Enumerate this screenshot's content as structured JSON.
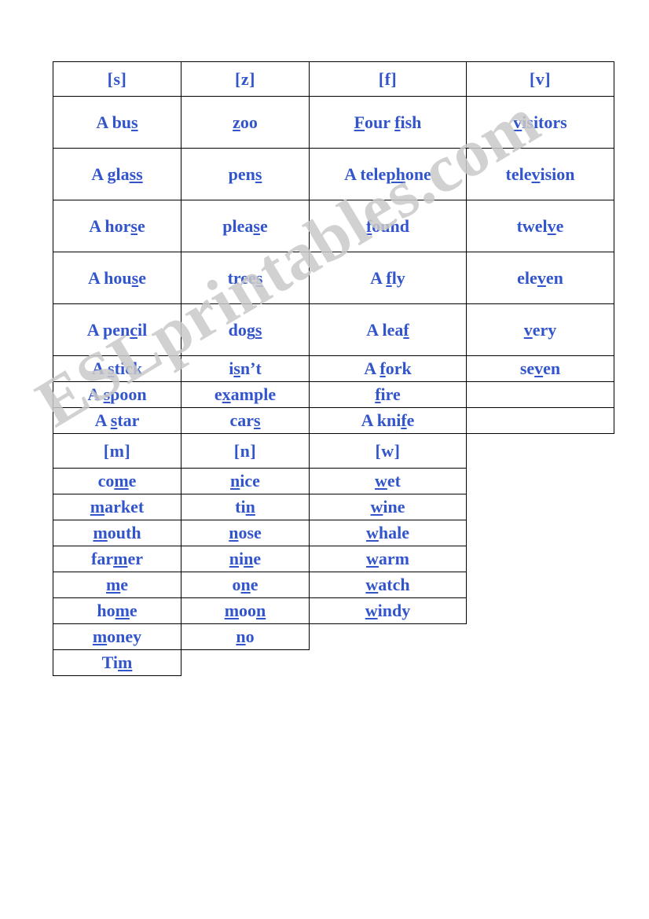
{
  "document": {
    "type": "pronunciation-worksheet",
    "watermark": "ESLprintables.com",
    "colors": {
      "header_red": "#dd1111",
      "word_blue": "#3355cc",
      "border": "#000000",
      "watermark_gray": "#c9c9c9"
    }
  },
  "table": {
    "headers": [
      "[s]",
      "[z]",
      "[f]",
      "[v]",
      "[m]",
      "[n]",
      "[w]"
    ],
    "sound_s": {
      "symbol": "[s]",
      "words": [
        {
          "text": "A bus",
          "pre": "A bu",
          "mark": "s",
          "post": ""
        },
        {
          "text": "A glass",
          "pre": "A gla",
          "mark": "ss",
          "post": ""
        },
        {
          "text": "A horse",
          "pre": "A hor",
          "mark": "s",
          "post": "e"
        },
        {
          "text": "A house",
          "pre": "A hou",
          "mark": "s",
          "post": "e"
        },
        {
          "text": "A pencil",
          "pre": "A pen",
          "mark": "c",
          "post": "il"
        },
        {
          "text": "A stick",
          "pre": "A ",
          "mark": "s",
          "post": "tick"
        },
        {
          "text": "A spoon",
          "pre": "A ",
          "mark": "s",
          "post": "poon"
        },
        {
          "text": "A star",
          "pre": "A ",
          "mark": "s",
          "post": "tar"
        }
      ]
    },
    "sound_z": {
      "symbol": "[z]",
      "words": [
        {
          "text": "zoo",
          "pre": "",
          "mark": "z",
          "post": "oo"
        },
        {
          "text": "pens",
          "pre": "pen",
          "mark": "s",
          "post": ""
        },
        {
          "text": "please",
          "pre": "plea",
          "mark": "s",
          "post": "e"
        },
        {
          "text": "trees",
          "pre": "tree",
          "mark": "s",
          "post": ""
        },
        {
          "text": "dogs",
          "pre": "dog",
          "mark": "s",
          "post": ""
        },
        {
          "text": "isn’t",
          "pre": "i",
          "mark": "s",
          "post": "n’t"
        },
        {
          "text": "example",
          "pre": "e",
          "mark": "x",
          "post": "ample"
        },
        {
          "text": "cars",
          "pre": "car",
          "mark": "s",
          "post": ""
        }
      ]
    },
    "sound_f": {
      "symbol": "[f]",
      "words": [
        {
          "text": "Four fish",
          "pre": "",
          "mark": "F",
          "post": "our ",
          "mark2": "f",
          "post2": "ish"
        },
        {
          "text": "A telephone",
          "pre": "A tele",
          "mark": "ph",
          "post": "one"
        },
        {
          "text": "found",
          "pre": "",
          "mark": "f",
          "post": "ound"
        },
        {
          "text": "A fly",
          "pre": "A ",
          "mark": "f",
          "post": "ly"
        },
        {
          "text": "A leaf",
          "pre": "A lea",
          "mark": "f",
          "post": ""
        },
        {
          "text": "A fork",
          "pre": "A ",
          "mark": "f",
          "post": "ork"
        },
        {
          "text": "fire",
          "pre": "",
          "mark": "f",
          "post": "ire"
        },
        {
          "text": "A knife",
          "pre": "A kni",
          "mark": "f",
          "post": "e"
        }
      ]
    },
    "sound_v": {
      "symbol": "[v]",
      "words": [
        {
          "text": "visitors",
          "pre": "",
          "mark": "v",
          "post": "isitors"
        },
        {
          "text": "television",
          "pre": "tele",
          "mark": "v",
          "post": "ision"
        },
        {
          "text": "twelve",
          "pre": "twel",
          "mark": "v",
          "post": "e"
        },
        {
          "text": "eleven",
          "pre": "ele",
          "mark": "v",
          "post": "en"
        },
        {
          "text": "very",
          "pre": "",
          "mark": "v",
          "post": "ery"
        },
        {
          "text": "seven",
          "pre": "se",
          "mark": "v",
          "post": "en"
        }
      ]
    },
    "sound_m": {
      "symbol": "[m]",
      "words": [
        {
          "text": "come",
          "pre": "co",
          "mark": "m",
          "post": "e"
        },
        {
          "text": "market",
          "pre": "",
          "mark": "m",
          "post": "arket"
        },
        {
          "text": "mouth",
          "pre": "",
          "mark": "m",
          "post": "outh"
        },
        {
          "text": "farmer",
          "pre": "far",
          "mark": "m",
          "post": "er"
        },
        {
          "text": "me",
          "pre": "",
          "mark": "m",
          "post": "e"
        },
        {
          "text": "home",
          "pre": "ho",
          "mark": "m",
          "post": "e"
        },
        {
          "text": "money",
          "pre": "",
          "mark": "m",
          "post": "oney"
        },
        {
          "text": "Tim",
          "pre": "Ti",
          "mark": "m",
          "post": ""
        }
      ]
    },
    "sound_n": {
      "symbol": "[n]",
      "words": [
        {
          "text": "nice",
          "pre": "",
          "mark": "n",
          "post": "ice"
        },
        {
          "text": "tin",
          "pre": "ti",
          "mark": "n",
          "post": ""
        },
        {
          "text": "nose",
          "pre": "",
          "mark": "n",
          "post": "ose"
        },
        {
          "text": "nine",
          "pre": "",
          "mark": "n",
          "post": "i",
          "mark2": "n",
          "post2": "e"
        },
        {
          "text": "one",
          "pre": "o",
          "mark": "n",
          "post": "e"
        },
        {
          "text": "moon",
          "pre": "",
          "mark": "m",
          "post": "oo",
          "mark2": "n",
          "post2": ""
        },
        {
          "text": "no",
          "pre": "",
          "mark": "n",
          "post": "o"
        }
      ]
    },
    "sound_w": {
      "symbol": "[w]",
      "words": [
        {
          "text": "wet",
          "pre": "",
          "mark": "w",
          "post": "et"
        },
        {
          "text": "wine",
          "pre": "",
          "mark": "w",
          "post": "ine"
        },
        {
          "text": "whale",
          "pre": "",
          "mark": "w",
          "post": "hale"
        },
        {
          "text": "warm",
          "pre": "",
          "mark": "w",
          "post": "arm"
        },
        {
          "text": "watch",
          "pre": "",
          "mark": "w",
          "post": "atch"
        },
        {
          "text": "windy",
          "pre": "",
          "mark": "w",
          "post": "indy"
        }
      ]
    }
  }
}
